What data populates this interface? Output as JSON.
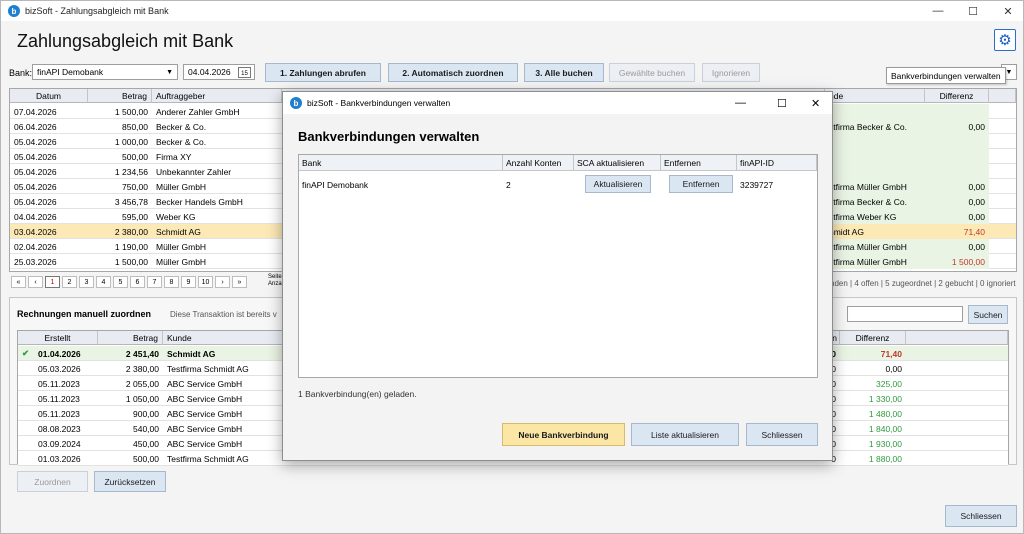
{
  "app": {
    "title": "bizSoft - Zahlungsabgleich mit Bank",
    "icon_letter": "b",
    "heading": "Zahlungsabgleich mit Bank"
  },
  "window_controls": {
    "minimize": "—",
    "maximize": "☐",
    "close": "✕"
  },
  "toolbar": {
    "bank_label": "Bank:",
    "bank_value": "finAPI Demobank",
    "date_value": "04.04.2026",
    "btn_fetch": "1. Zahlungen abrufen",
    "btn_auto": "2. Automatisch zuordnen",
    "btn_book_all": "3. Alle buchen",
    "btn_book_selected": "Gewählte buchen",
    "btn_ignore": "Ignorieren",
    "tooltip": "Bankverbindungen verwalten",
    "calendar_day": "15"
  },
  "payments": {
    "headers": {
      "date": "Datum",
      "amount": "Betrag",
      "payer": "Auftraggeber",
      "customer": "nde",
      "difference": "Differenz"
    },
    "rows": [
      {
        "date": "07.04.2026",
        "amount": "1 500,00",
        "payer": "Anderer Zahler GmbH",
        "customer": "",
        "difference": ""
      },
      {
        "date": "06.04.2026",
        "amount": "850,00",
        "payer": "Becker & Co.",
        "customer": "stfirma Becker & Co.",
        "difference": "0,00"
      },
      {
        "date": "05.04.2026",
        "amount": "1 000,00",
        "payer": "Becker & Co.",
        "customer": "",
        "difference": ""
      },
      {
        "date": "05.04.2026",
        "amount": "500,00",
        "payer": "Firma XY",
        "customer": "",
        "difference": ""
      },
      {
        "date": "05.04.2026",
        "amount": "1 234,56",
        "payer": "Unbekannter Zahler",
        "customer": "",
        "difference": ""
      },
      {
        "date": "05.04.2026",
        "amount": "750,00",
        "payer": "Müller GmbH",
        "customer": "stfirma Müller GmbH",
        "difference": "0,00"
      },
      {
        "date": "05.04.2026",
        "amount": "3 456,78",
        "payer": "Becker Handels GmbH",
        "customer": "stfirma Becker & Co.",
        "difference": "0,00"
      },
      {
        "date": "04.04.2026",
        "amount": "595,00",
        "payer": "Weber KG",
        "customer": "stfirma Weber KG",
        "difference": "0,00"
      },
      {
        "date": "03.04.2026",
        "amount": "2 380,00",
        "payer": "Schmidt AG",
        "customer": "hmidt AG",
        "difference": "71,40"
      },
      {
        "date": "02.04.2026",
        "amount": "1 190,00",
        "payer": "Müller GmbH",
        "customer": "stfirma Müller GmbH",
        "difference": "0,00"
      },
      {
        "date": "25.03.2026",
        "amount": "1 500,00",
        "payer": "Müller GmbH",
        "customer": "stfirma Müller GmbH",
        "difference": "1 500,00"
      }
    ],
    "pager": [
      "«",
      "‹",
      "1",
      "2",
      "3",
      "4",
      "5",
      "6",
      "7",
      "8",
      "9",
      "10",
      "›",
      "»"
    ],
    "pager_info_1": "Seite",
    "pager_info_2": "Anza",
    "status": "nden | 4 offen | 5 zugeordnet | 2 gebucht | 0 ignoriert"
  },
  "manual": {
    "title": "Rechnungen manuell zuordnen",
    "hint": "Diese Transaktion ist bereits v",
    "search_button": "Suchen",
    "headers": {
      "created": "Erstellt",
      "amount": "Betrag",
      "customer": "Kunde",
      "n": "n",
      "difference": "Differenz"
    },
    "rows": [
      {
        "check": "✔",
        "created": "01.04.2026",
        "amount": "2 451,40",
        "customer": "Schmidt AG",
        "n": "0",
        "difference": "71,40"
      },
      {
        "check": "",
        "created": "05.03.2026",
        "amount": "2 380,00",
        "customer": "Testfirma Schmidt AG",
        "n": "0",
        "difference": "0,00"
      },
      {
        "check": "",
        "created": "05.11.2023",
        "amount": "2 055,00",
        "customer": "ABC Service GmbH",
        "n": "0",
        "difference": "325,00"
      },
      {
        "check": "",
        "created": "05.11.2023",
        "amount": "1 050,00",
        "customer": "ABC Service GmbH",
        "n": "0",
        "difference": "1 330,00"
      },
      {
        "check": "",
        "created": "05.11.2023",
        "amount": "900,00",
        "customer": "ABC Service GmbH",
        "n": "0",
        "difference": "1 480,00"
      },
      {
        "check": "",
        "created": "08.08.2023",
        "amount": "540,00",
        "customer": "ABC Service GmbH",
        "n": "0",
        "difference": "1 840,00"
      },
      {
        "check": "",
        "created": "03.09.2024",
        "amount": "450,00",
        "customer": "ABC Service GmbH",
        "n": "0",
        "difference": "1 930,00"
      },
      {
        "check": "",
        "created": "01.03.2026",
        "amount": "500,00",
        "customer": "Testfirma Schmidt AG",
        "n": "0",
        "difference": "1 880,00"
      }
    ],
    "btn_assign": "Zuordnen",
    "btn_reset": "Zurücksetzen"
  },
  "footer": {
    "close_button": "Schliessen"
  },
  "dialog": {
    "title": "bizSoft - Bankverbindungen verwalten",
    "heading": "Bankverbindungen verwalten",
    "headers": {
      "bank": "Bank",
      "accounts": "Anzahl Konten",
      "sca": "SCA aktualisieren",
      "remove": "Entfernen",
      "finapi_id": "finAPI-ID"
    },
    "rows": [
      {
        "bank": "finAPI Demobank",
        "accounts": "2",
        "sca_button": "Aktualisieren",
        "remove_button": "Entfernen",
        "finapi_id": "3239727"
      }
    ],
    "status": "1 Bankverbindung(en) geladen.",
    "btn_new": "Neue Bankverbindung",
    "btn_refresh": "Liste aktualisieren",
    "btn_close": "Schliessen"
  },
  "colors": {
    "accent": "#1e7fd0",
    "selected_row": "#fce9b6",
    "difference_red": "#c0392b",
    "difference_green": "#2e9a3e",
    "green_row": "#eaf4e4"
  }
}
